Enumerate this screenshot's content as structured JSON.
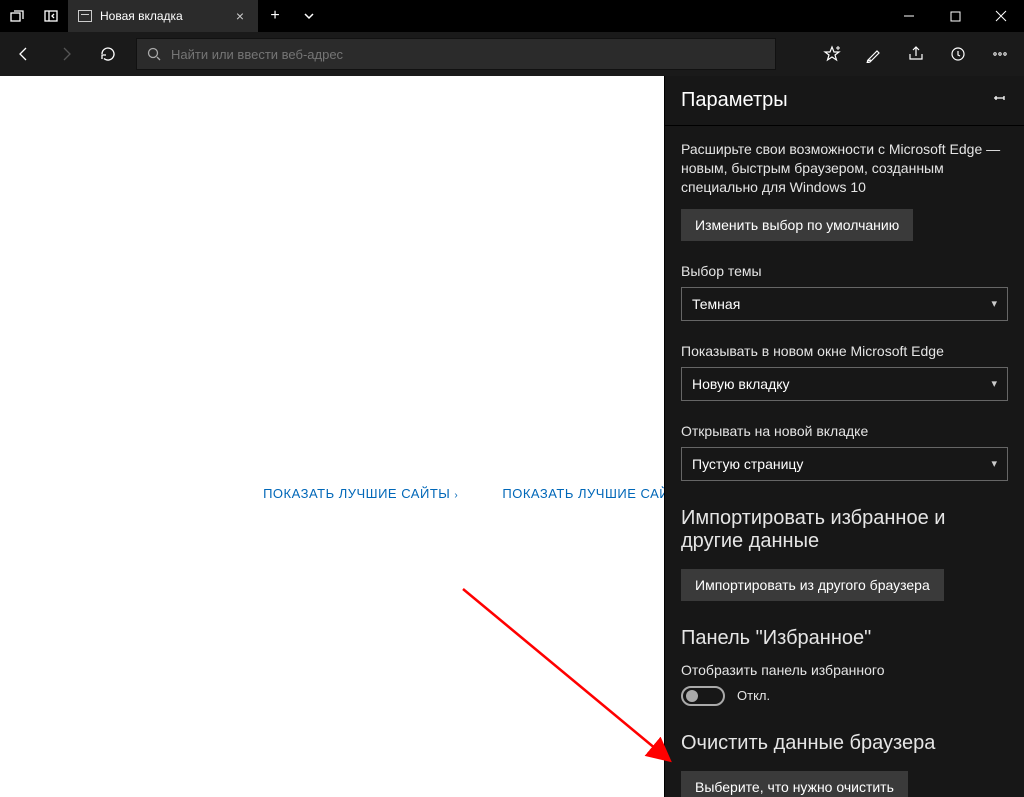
{
  "tab": {
    "title": "Новая вкладка"
  },
  "addressbar": {
    "placeholder": "Найти или ввести веб-адрес"
  },
  "newtab": {
    "link1": "ПОКАЗАТЬ ЛУЧШИЕ САЙТЫ",
    "link2": "ПОКАЗАТЬ ЛУЧШИЕ САЙТЫ И ЛЕНТУ"
  },
  "settings": {
    "title": "Параметры",
    "promo": "Расширьте свои возможности с Microsoft Edge — новым, быстрым браузером, созданным специально для Windows 10",
    "change_default_btn": "Изменить выбор по умолчанию",
    "theme_label": "Выбор темы",
    "theme_value": "Темная",
    "open_with_label": "Показывать в новом окне Microsoft Edge",
    "open_with_value": "Новую вкладку",
    "newtab_label": "Открывать на новой вкладке",
    "newtab_value": "Пустую страницу",
    "import_heading": "Импортировать избранное и другие данные",
    "import_btn": "Импортировать из другого браузера",
    "favbar_heading": "Панель \"Избранное\"",
    "favbar_show_label": "Отобразить панель избранного",
    "favbar_toggle_state": "Откл.",
    "clear_heading": "Очистить данные браузера",
    "clear_btn": "Выберите, что нужно очистить"
  }
}
